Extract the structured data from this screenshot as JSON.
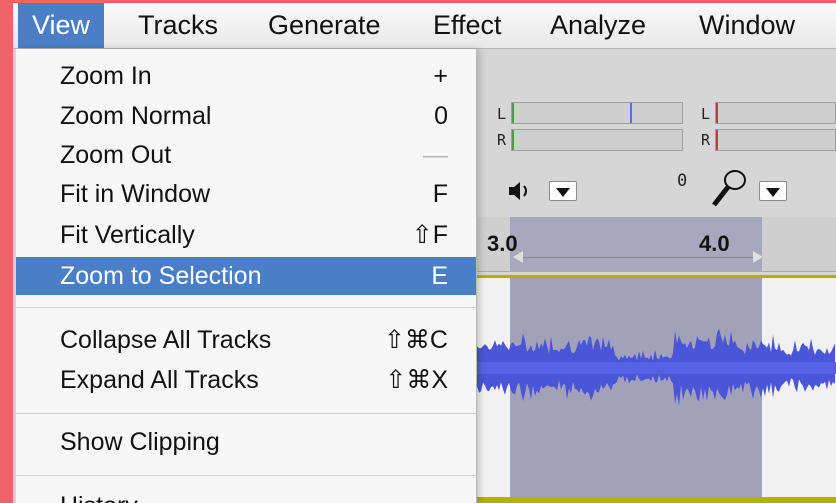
{
  "menubar": {
    "items": [
      {
        "label": "View",
        "active": true
      },
      {
        "label": "Tracks"
      },
      {
        "label": "Generate"
      },
      {
        "label": "Effect"
      },
      {
        "label": "Analyze"
      },
      {
        "label": "Window"
      }
    ]
  },
  "view_menu": {
    "items": [
      {
        "label": "Zoom In",
        "shortcut": "+"
      },
      {
        "label": "Zoom Normal",
        "shortcut": "0"
      },
      {
        "label": "Zoom Out",
        "shortcut": "—",
        "disabled_shortcut": true
      },
      {
        "label": "Fit in Window",
        "shortcut": "F"
      },
      {
        "label": "Fit Vertically",
        "shortcut": "⇧F"
      },
      {
        "label": "Zoom to Selection",
        "shortcut": "E",
        "selected": true
      },
      {
        "label": "Collapse All Tracks",
        "shortcut": "⇧⌘C"
      },
      {
        "label": "Expand All Tracks",
        "shortcut": "⇧⌘X"
      },
      {
        "label": "Show Clipping",
        "shortcut": ""
      },
      {
        "label": "History",
        "shortcut": ""
      }
    ]
  },
  "meters": {
    "playback_left": "L",
    "playback_right": "R",
    "record_left": "L",
    "record_right": "R",
    "zero_label": "0"
  },
  "ruler": {
    "label_1": "3.0",
    "label_2": "4.0"
  },
  "colors": {
    "accent": "#4a7fc8",
    "waveform": "#4a55d8",
    "selection": "#a1a1b9",
    "track_border": "#b3b200",
    "frame": "#ee6468"
  }
}
